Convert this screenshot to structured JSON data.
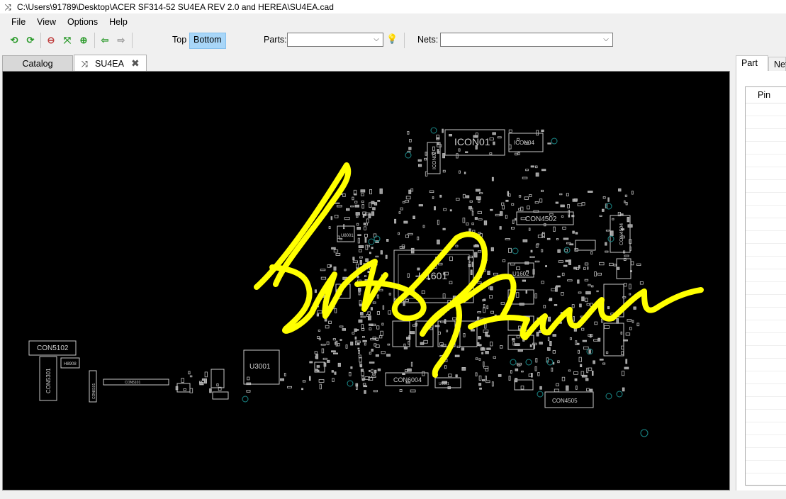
{
  "window": {
    "app_icon": "crossed-arrows-icon",
    "title": "C:\\Users\\91789\\Desktop\\ACER SF314-52 SU4EA REV 2.0 and HEREA\\SU4EA.cad"
  },
  "menu": [
    "File",
    "View",
    "Options",
    "Help"
  ],
  "toolbar": {
    "buttons": [
      "rotate-left-icon",
      "rotate-right-icon",
      "zoom-out-icon",
      "fit-view-icon",
      "zoom-in-icon",
      "arrow-left-icon",
      "arrow-right-icon"
    ],
    "layer_top": "Top",
    "layer_bottom": "Bottom",
    "active_layer": "Bottom",
    "parts_label": "Parts:",
    "parts_value": "",
    "nets_label": "Nets:",
    "nets_value": "",
    "highlight_icon": "lightbulb-icon"
  },
  "tabs": [
    {
      "label": "Catalog",
      "active": false
    },
    {
      "label": "SU4EA",
      "active": true,
      "icon": "crossed-arrows-icon",
      "closable": true
    }
  ],
  "board": {
    "labels": [
      "ICON01",
      "ICON04",
      "ICON02",
      "CON4502",
      "U8001",
      "CON4504",
      "U1601",
      "U1602",
      "U3001",
      "CON6004",
      "CON5102",
      "H8908",
      "CON5301",
      "CON6101",
      "CON5101",
      "CON4505",
      "U6001"
    ],
    "signature_color": "#ffff00",
    "board_color": "#000000",
    "outline_color": "#c8c8c8",
    "via_color": "#1a8a8a"
  },
  "right_panel": {
    "tabs": [
      "Part",
      "Net"
    ],
    "active_tab": "Part",
    "table_header": "Pin",
    "rows": []
  }
}
